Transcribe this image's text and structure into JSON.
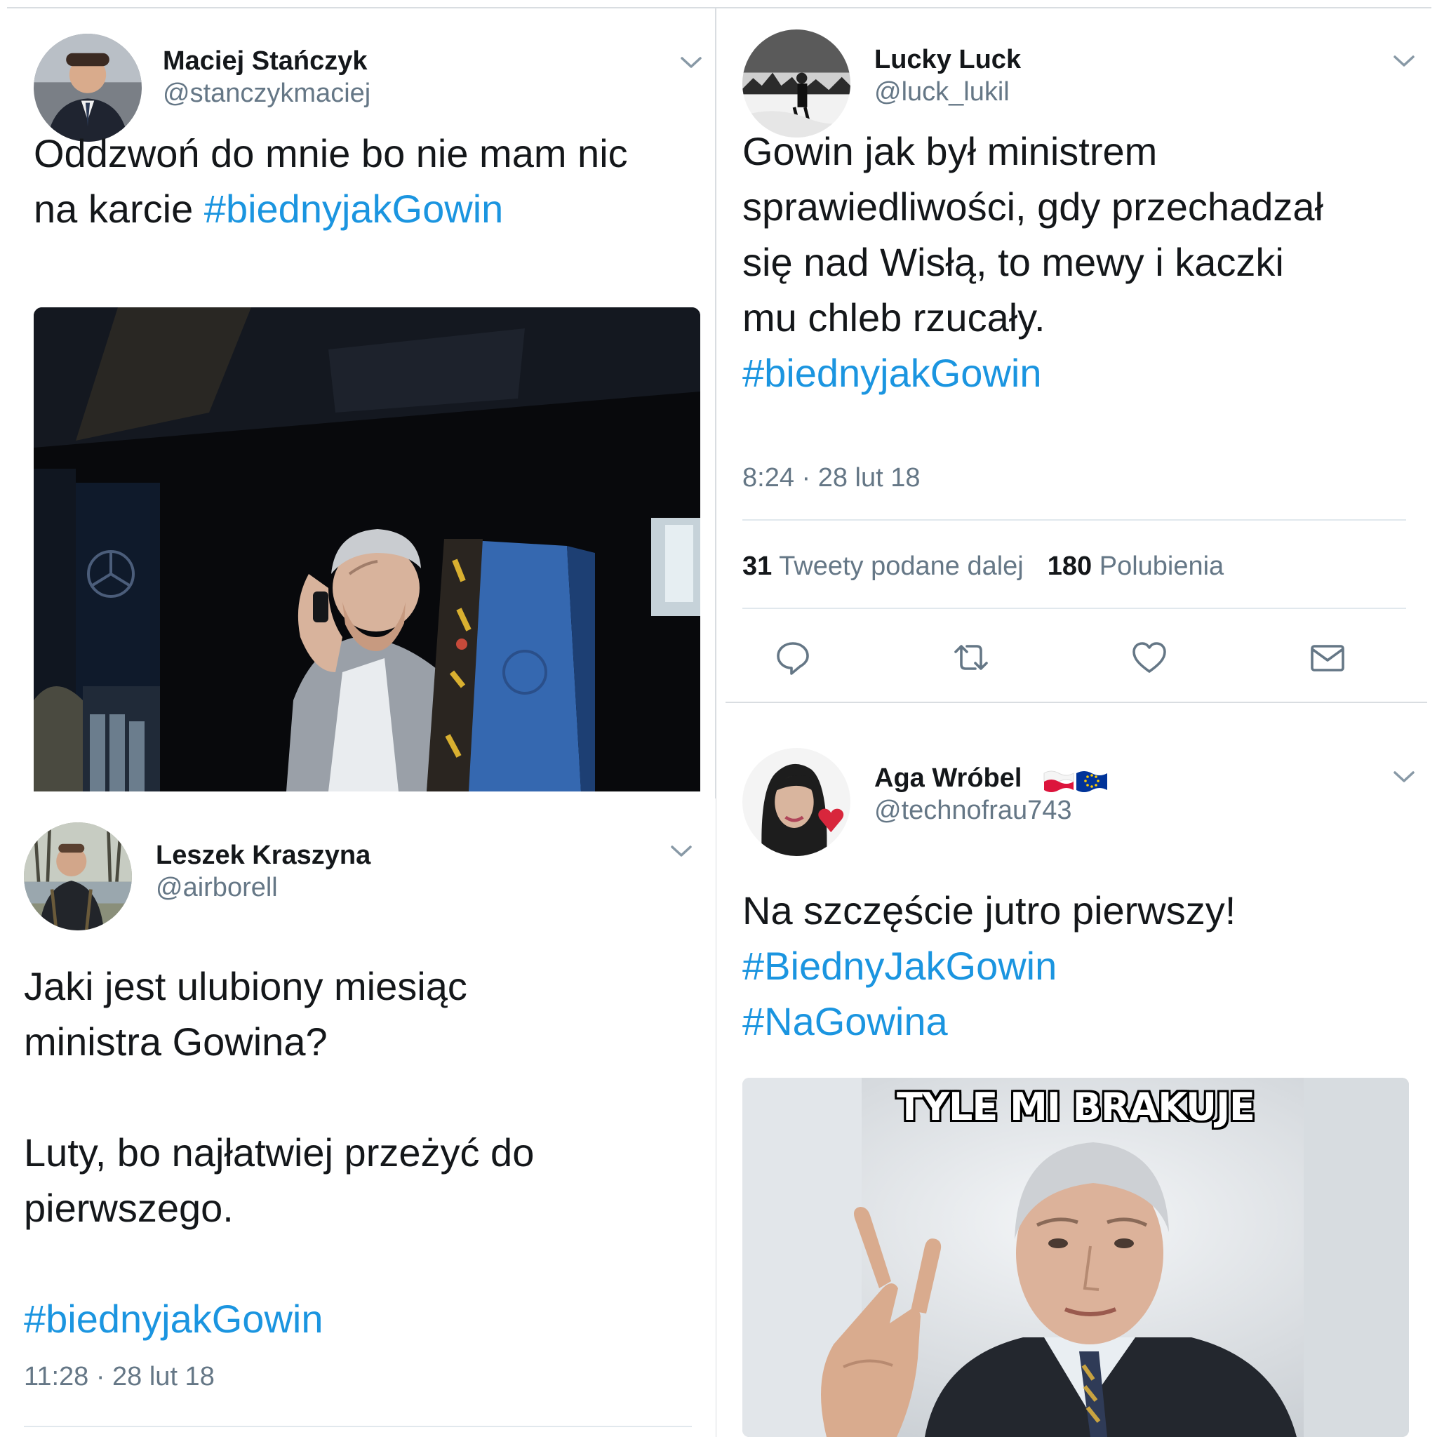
{
  "tweets": [
    {
      "name": "Maciej Stańczyk",
      "handle": "@stanczykmaciej",
      "lines": [
        {
          "text": "Oddzwoń do mnie bo nie mam nic",
          "tag": ""
        },
        {
          "text": "na karcie ",
          "tag": "#biednyjakGowin"
        }
      ]
    },
    {
      "name": "Lucky Luck",
      "handle": "@luck_lukil",
      "lines": [
        {
          "text": "Gowin jak był ministrem",
          "tag": ""
        },
        {
          "text": "sprawiedliwości, gdy przechadzał",
          "tag": ""
        },
        {
          "text": "się nad Wisłą, to mewy i kaczki",
          "tag": ""
        },
        {
          "text": "mu chleb rzucały.",
          "tag": ""
        },
        {
          "text": "",
          "tag": "#biednyjakGowin"
        }
      ],
      "timestamp": "8:24 · 28 lut 18",
      "retweets_count": "31",
      "retweets_label": "Tweety podane dalej",
      "likes_count": "180",
      "likes_label": "Polubienia"
    },
    {
      "name": "Leszek Kraszyna",
      "handle": "@airborell",
      "lines": [
        {
          "text": "Jaki jest ulubiony miesiąc",
          "tag": ""
        },
        {
          "text": "ministra Gowina?",
          "tag": ""
        },
        {
          "text": "",
          "tag": ""
        },
        {
          "text": "Luty, bo najłatwiej przeżyć do",
          "tag": ""
        },
        {
          "text": "pierwszego.",
          "tag": ""
        },
        {
          "text": "",
          "tag": ""
        },
        {
          "text": "",
          "tag": "#biednyjakGowin"
        }
      ],
      "timestamp": "11:28 · 28 lut 18"
    },
    {
      "name": "Aga Wróbel",
      "handle": "@technofrau743",
      "lines": [
        {
          "text": "Na szczęście jutro pierwszy!",
          "tag": ""
        },
        {
          "text": "",
          "tag": "#BiednyJakGowin"
        },
        {
          "text": "",
          "tag": "#NaGowina"
        }
      ],
      "meme_caption": "TYLE MI BRAKUJE"
    }
  ],
  "colors": {
    "link": "#1b95e0",
    "secondary_text": "#657786",
    "primary_text": "#14171a",
    "divider": "#e1e8ed"
  },
  "icons": [
    "chevron-down-icon",
    "reply-icon",
    "retweet-icon",
    "like-icon",
    "direct-message-icon",
    "poland-flag-icon",
    "eu-flag-icon"
  ]
}
